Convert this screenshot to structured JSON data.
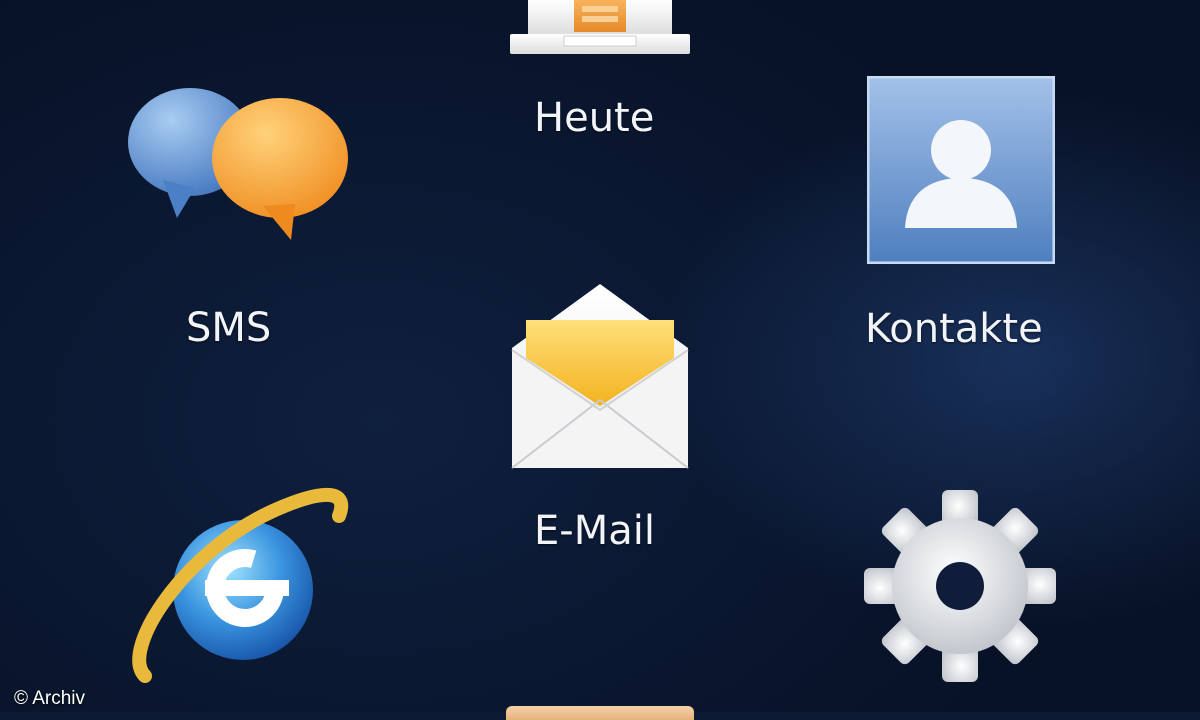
{
  "tiles": {
    "heute": {
      "label": "Heute",
      "icon": "today-icon"
    },
    "sms": {
      "label": "SMS",
      "icon": "sms-icon"
    },
    "kontakte": {
      "label": "Kontakte",
      "icon": "contacts-icon"
    },
    "email": {
      "label": "E-Mail",
      "icon": "mail-icon"
    },
    "internet_explorer": {
      "label": "",
      "icon": "internet-explorer-icon"
    },
    "settings": {
      "label": "",
      "icon": "settings-icon"
    },
    "bottom_partial": {
      "label": "",
      "icon": "partially-visible-tile-icon"
    }
  },
  "credit": "© Archiv",
  "colors": {
    "background": "#0b1732",
    "label_text": "#f2f4f8",
    "sms_blue": "#5d8fd3",
    "sms_orange": "#f5a02f",
    "contacts_tile": "#6e99cf",
    "mail_yellow": "#f8c93a",
    "ie_blue": "#2d7fd0",
    "ie_ring": "#e6b53a",
    "gear_gray": "#cfd3d8"
  }
}
